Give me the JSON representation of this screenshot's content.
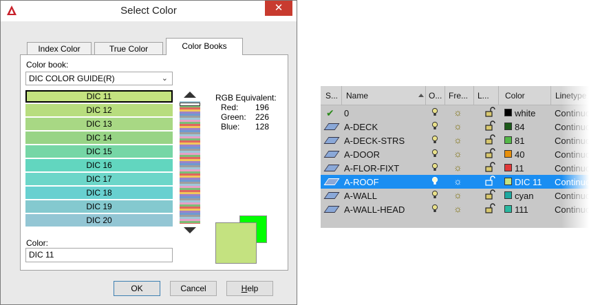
{
  "dialog": {
    "title": "Select Color",
    "close_glyph": "✕",
    "tabs": [
      "Index Color",
      "True Color",
      "Color Books"
    ],
    "active_tab": "Color Books",
    "color_book_label": "Color book:",
    "color_book_value": "DIC COLOR GUIDE(R)",
    "swatches": [
      {
        "name": "DIC 11",
        "color": "#c4e280"
      },
      {
        "name": "DIC 12",
        "color": "#b8dd7e"
      },
      {
        "name": "DIC 13",
        "color": "#a8d884"
      },
      {
        "name": "DIC 14",
        "color": "#98d486"
      },
      {
        "name": "DIC 15",
        "color": "#76d6a6"
      },
      {
        "name": "DIC 16",
        "color": "#62d6bf"
      },
      {
        "name": "DIC 17",
        "color": "#6cd6c9"
      },
      {
        "name": "DIC 18",
        "color": "#68d0d0"
      },
      {
        "name": "DIC 19",
        "color": "#84c9cf"
      },
      {
        "name": "DIC 20",
        "color": "#93c6d4"
      }
    ],
    "selected_swatch": "DIC 11",
    "rgb": {
      "heading": "RGB Equivalent:",
      "red_label": "Red:",
      "red_value": "196",
      "green_label": "Green:",
      "green_value": "226",
      "blue_label": "Blue:",
      "blue_value": "128"
    },
    "color_label": "Color:",
    "color_value": "DIC 11",
    "preview_new_color": "#00ff00",
    "preview_old_color": "#c4e280",
    "buttons": {
      "ok": "OK",
      "cancel": "Cancel",
      "help_first": "H",
      "help_rest": "elp"
    }
  },
  "layers": {
    "headers": {
      "status": "S...",
      "name": "Name",
      "on": "O...",
      "freeze": "Fre...",
      "lock": "L...",
      "color": "Color",
      "linetype": "Linetype"
    },
    "rows": [
      {
        "name": "0",
        "color_name": "white",
        "swatch": "#000000",
        "linetype": "Continuous",
        "current": true
      },
      {
        "name": "A-DECK",
        "color_name": "84",
        "swatch": "#1c5a1a",
        "linetype": "Continuous"
      },
      {
        "name": "A-DECK-STRS",
        "color_name": "81",
        "swatch": "#54b848",
        "linetype": "Continuous"
      },
      {
        "name": "A-DOOR",
        "color_name": "40",
        "swatch": "#e8900c",
        "linetype": "Continuous"
      },
      {
        "name": "A-FLOR-FIXT",
        "color_name": "11",
        "swatch": "#e03a3a",
        "linetype": "Continuous"
      },
      {
        "name": "A-ROOF",
        "color_name": "DIC 11",
        "swatch": "#c4e280",
        "linetype": "Continuous",
        "selected": true
      },
      {
        "name": "A-WALL",
        "color_name": "cyan",
        "swatch": "#1fa8a0",
        "linetype": "Continuous"
      },
      {
        "name": "A-WALL-HEAD",
        "color_name": "111",
        "swatch": "#2ab8a0",
        "linetype": "Continuous"
      }
    ],
    "status_current_glyph": "✔"
  }
}
